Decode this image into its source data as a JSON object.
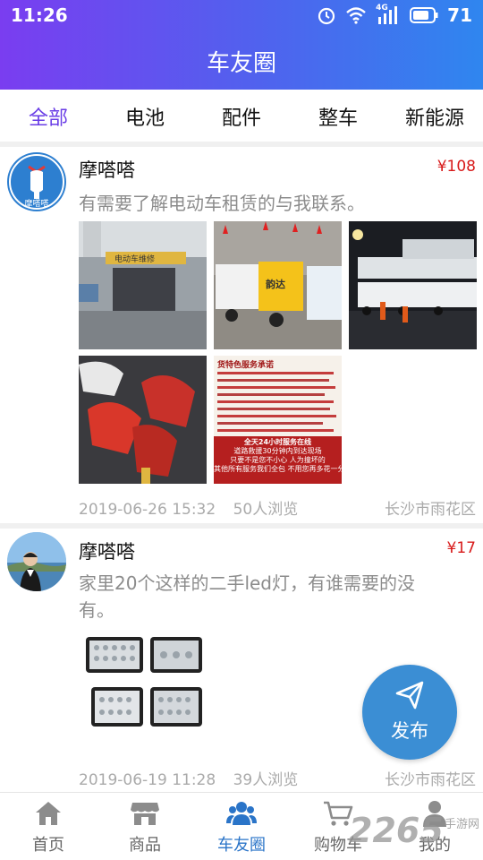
{
  "status": {
    "time": "11:26",
    "network": "4G",
    "battery": "71"
  },
  "header": {
    "title": "车友圈"
  },
  "tabs": [
    "全部",
    "电池",
    "配件",
    "整车",
    "新能源"
  ],
  "posts": [
    {
      "name": "摩嗒嗒",
      "avatar_label": "摩嗒嗒",
      "price": "¥108",
      "content": "有需要了解电动车租赁的与我联系。",
      "date": "2019-06-26 15:32",
      "views": "50人浏览",
      "location": "长沙市雨花区",
      "images": [
        {
          "sign": "电动车维修"
        },
        {
          "label": "韵达"
        },
        {
          "label": ""
        },
        {
          "label": ""
        },
        {
          "heading": "货特色服务承诺",
          "line1": "全天24小时服务在线",
          "line2": "道路救援30分钟内到达现场",
          "line3": "只要不是您不小心 人为撞坏的",
          "line4": "其他所有服务我们全包 不用您再多花一分"
        }
      ]
    },
    {
      "name": "摩嗒嗒",
      "price": "¥17",
      "content": "家里20个这样的二手led灯，有谁需要的没有。",
      "date": "2019-06-19 11:28",
      "views": "39人浏览",
      "location": "长沙市雨花区"
    }
  ],
  "fab": {
    "label": "发布",
    "icon": "paper-plane-icon"
  },
  "bottom_nav": [
    {
      "label": "首页",
      "icon": "home-icon"
    },
    {
      "label": "商品",
      "icon": "shop-icon"
    },
    {
      "label": "车友圈",
      "icon": "friends-icon",
      "active": true
    },
    {
      "label": "购物车",
      "icon": "cart-icon"
    },
    {
      "label": "我的",
      "icon": "person-icon"
    }
  ],
  "watermark": {
    "number": "2265",
    "text": "手游网"
  },
  "colors": {
    "header_start": "#7a3df0",
    "header_end": "#2f86ef",
    "tab_active": "#6a3ee6",
    "price": "#d81b1b",
    "fab": "#3b8ed4",
    "nav_active": "#2a74c8"
  }
}
